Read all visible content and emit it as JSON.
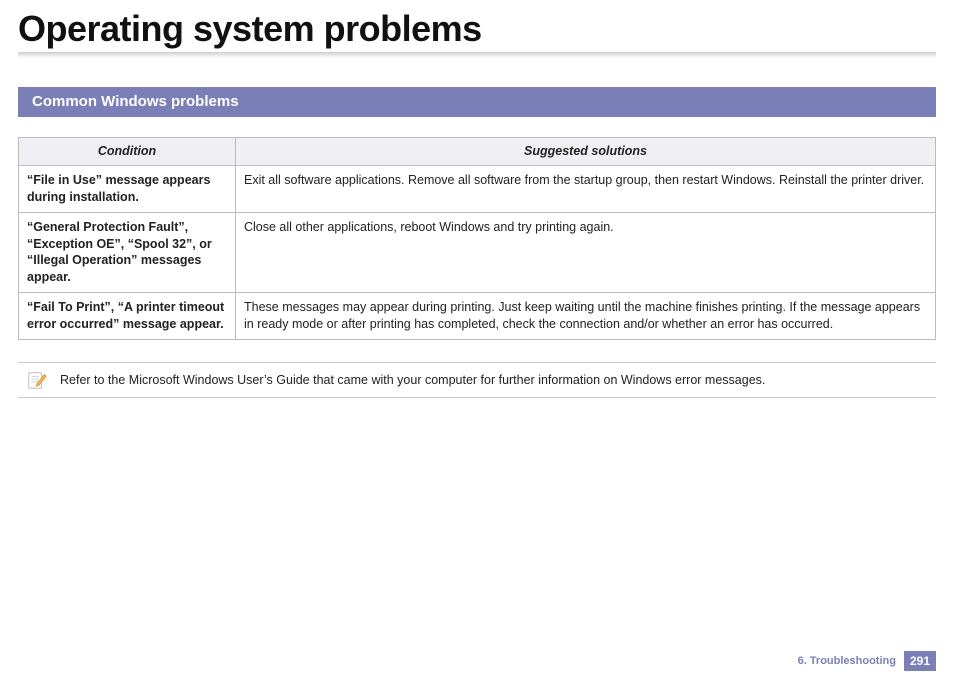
{
  "title": "Operating system problems",
  "section_heading": "Common Windows problems",
  "table": {
    "headers": {
      "condition": "Condition",
      "solutions": "Suggested solutions"
    },
    "rows": [
      {
        "condition": "“File in Use” message appears during installation.",
        "solution": "Exit all software applications. Remove all software from the startup group, then restart Windows. Reinstall the printer driver."
      },
      {
        "condition": "“General Protection Fault”, “Exception OE”, “Spool 32”, or “Illegal Operation” messages appear.",
        "solution": "Close all other applications, reboot Windows and try printing again."
      },
      {
        "condition": "“Fail To Print”, “A printer timeout error occurred” message appear.",
        "solution": "These messages may appear during printing. Just keep waiting until the machine finishes printing. If the message appears in ready mode or after printing has completed, check the connection and/or whether an error has occurred."
      }
    ]
  },
  "note_text": "Refer to the Microsoft Windows User’s Guide that came with your computer for further information on Windows error messages.",
  "footer": {
    "chapter": "6.  Troubleshooting",
    "page": "291"
  }
}
